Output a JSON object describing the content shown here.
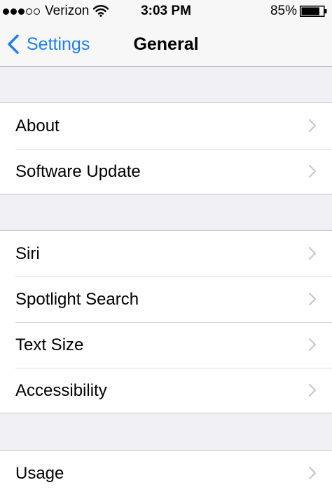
{
  "status_bar": {
    "signal_bars_filled": 3,
    "signal_bars_total": 5,
    "carrier": "Verizon",
    "time": "3:03 PM",
    "battery_percent": "85%",
    "battery_level": 0.85
  },
  "nav": {
    "back_label": "Settings",
    "title": "General"
  },
  "groups": [
    {
      "items": [
        {
          "label": "About"
        },
        {
          "label": "Software Update"
        }
      ]
    },
    {
      "items": [
        {
          "label": "Siri"
        },
        {
          "label": "Spotlight Search"
        },
        {
          "label": "Text Size"
        },
        {
          "label": "Accessibility"
        }
      ]
    },
    {
      "items": [
        {
          "label": "Usage"
        }
      ]
    }
  ],
  "colors": {
    "accent": "#1f7ef3",
    "background": "#efeff4",
    "separator": "#c8c7cc",
    "chevron": "#c7c7cc"
  },
  "icons": {
    "back": "chevron-left-icon",
    "row": "chevron-right-icon",
    "wifi": "wifi-icon",
    "battery": "battery-icon"
  }
}
